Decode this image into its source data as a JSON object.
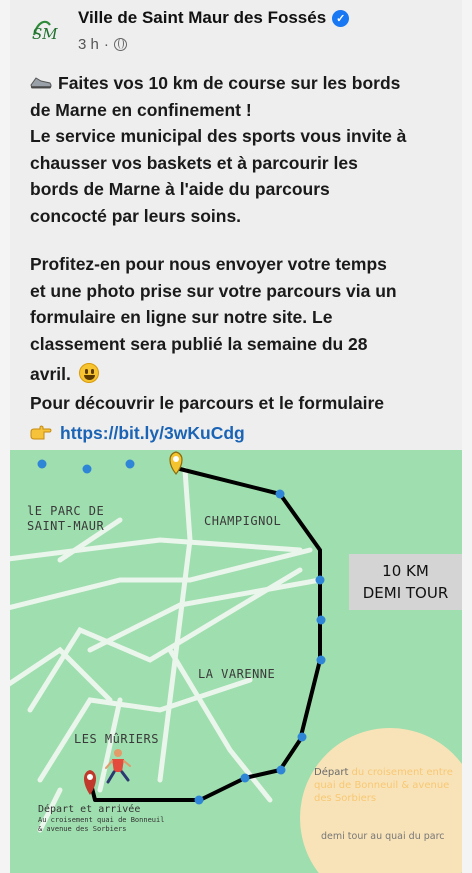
{
  "header": {
    "page_name": "Ville de Saint Maur des Fossés",
    "time": "3 h",
    "separator": "·",
    "logo_text": "SM"
  },
  "post": {
    "line1": "Faites vos 10 km de course sur les bords",
    "line2": "de Marne en confinement !",
    "line3": "Le service municipal des sports vous invite à",
    "line4": "chausser vos baskets et à parcourir les",
    "line5": "bords de Marne à l'aide du parcours",
    "line6": "concocté par leurs soins.",
    "line7": "Profitez-en pour nous envoyer votre temps",
    "line8": "et une photo prise sur votre parcours via un",
    "line9": "formulaire en ligne sur notre site. Le",
    "line10": "classement sera publié la semaine du 28",
    "line11": "avril.",
    "line12": "Pour découvrir le parcours et le formulaire",
    "link": "https://bit.ly/3wKuCdg"
  },
  "map": {
    "label_parc_1": "lE PARC DE",
    "label_parc_2": "SAINT-MAUR",
    "label_champignol": "CHAMPIGNOL",
    "label_varenne": "LA VARENNE",
    "label_muriers": "LES MûRIERS",
    "km_line1": "10 KM",
    "km_line2": "DEMI TOUR",
    "start_main": "Départ et arrivée",
    "start_sub1": "Au croisement quai de Bonneuil",
    "start_sub2": "& avenue des Sorbiers",
    "info_depart": "Départ",
    "info_rest": " du croisement entre quai de Bonneuil & avenue des Sorbiers",
    "info_demi": "demi tour au quai du parc",
    "colors": {
      "land": "#9fdeae",
      "road": "#eef6ee",
      "route": "#000000",
      "dots": "#2f86d6",
      "pin_yellow": "#f4c430",
      "pin_red": "#c0392b"
    }
  },
  "icons": {
    "verified": "verified-badge-icon",
    "globe": "globe-icon",
    "shoe": "running-shoe-icon",
    "smiley": "smiley-icon",
    "hand": "pointing-hand-icon"
  }
}
